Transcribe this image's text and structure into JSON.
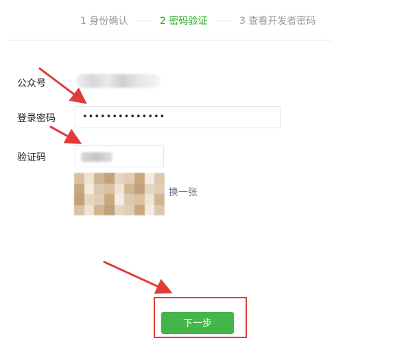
{
  "steps": [
    {
      "label": "1 身份确认",
      "active": false
    },
    {
      "label": "2 密码验证",
      "active": true
    },
    {
      "label": "3 查看开发者密码",
      "active": false
    }
  ],
  "form": {
    "account_label": "公众号",
    "password_label": "登录密码",
    "password_value": "••••••••••••••",
    "verify_label": "验证码",
    "refresh_label": "换一张"
  },
  "actions": {
    "next_label": "下一步"
  },
  "colors": {
    "accent_green": "#1aad19",
    "button_green": "#44b549",
    "link_blue": "#576b95",
    "annotation_red": "#e13b3b"
  }
}
